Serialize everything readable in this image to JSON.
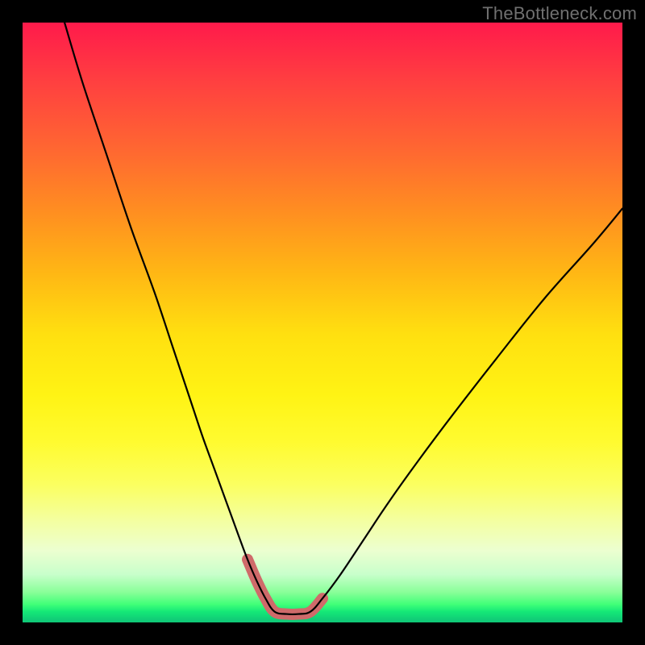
{
  "watermark": {
    "text": "TheBottleneck.com"
  },
  "layout": {
    "outer_size": 800,
    "plot_inset": 28,
    "plot_size": 744
  },
  "chart_data": {
    "type": "line",
    "title": "",
    "xlabel": "",
    "ylabel": "",
    "xlim": [
      0,
      100
    ],
    "ylim": [
      0,
      100
    ],
    "grid": false,
    "legend": false,
    "series": [
      {
        "name": "bottleneck-curve-black",
        "stroke": "#000000",
        "stroke_width": 2.2,
        "x": [
          7,
          10,
          14,
          18,
          22,
          25,
          28,
          30,
          32,
          34,
          36,
          37.5,
          39,
          40.5,
          42,
          44,
          46,
          48,
          50,
          53,
          57,
          61,
          66,
          72,
          79,
          87,
          95,
          100
        ],
        "values": [
          100,
          90,
          78,
          66,
          55,
          46,
          37,
          31,
          25.5,
          20,
          14.5,
          10.5,
          7,
          4,
          1.8,
          1.4,
          1.4,
          1.8,
          4,
          8,
          14,
          20,
          27,
          35,
          44,
          54,
          63,
          69
        ]
      },
      {
        "name": "bottleneck-curve-highlight",
        "stroke": "#cf6a6a",
        "stroke_width": 14,
        "linecap": "round",
        "x": [
          37.5,
          39,
          40.5,
          42,
          44,
          46,
          48,
          50
        ],
        "values": [
          10.5,
          7,
          4,
          1.8,
          1.4,
          1.4,
          1.8,
          4
        ]
      }
    ],
    "annotations": []
  }
}
